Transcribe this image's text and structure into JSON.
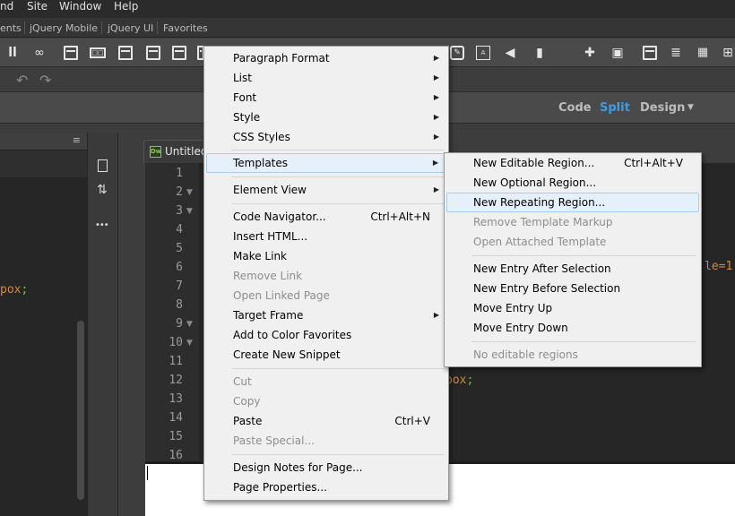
{
  "menubar": {
    "items": [
      "nd",
      "Site",
      "Window",
      "Help"
    ]
  },
  "insert_tabs": [
    "ents",
    "jQuery Mobile",
    "jQuery UI",
    "Favorites"
  ],
  "view_bar": {
    "code": "Code",
    "split": "Split",
    "design": "Design",
    "dropdown_arrow": "▼"
  },
  "document": {
    "tab_title": "Untitled",
    "dw_badge": "Dw"
  },
  "editor": {
    "line_numbers": [
      "1",
      "2",
      "3",
      "4",
      "5",
      "6",
      "7",
      "8",
      "9",
      "10",
      "11",
      "12",
      "13",
      "14",
      "15",
      "16"
    ],
    "left_fragment": "pox",
    "left_fragment_punct": ";",
    "right_fragment": "le=1",
    "box_fragment": "pox",
    "box_fragment_punct": ";"
  },
  "context_menu": {
    "items": [
      {
        "label": "Paragraph Format",
        "submenu": true
      },
      {
        "label": "List",
        "submenu": true
      },
      {
        "label": "Font",
        "submenu": true
      },
      {
        "label": "Style",
        "submenu": true
      },
      {
        "label": "CSS Styles",
        "submenu": true
      },
      {
        "label": "Templates",
        "submenu": true,
        "highlighted": true
      },
      {
        "label": "Element View",
        "submenu": true
      },
      {
        "label": "Code Navigator...",
        "shortcut": "Ctrl+Alt+N"
      },
      {
        "label": "Insert HTML..."
      },
      {
        "label": "Make Link"
      },
      {
        "label": "Remove Link",
        "disabled": true
      },
      {
        "label": "Open Linked Page",
        "disabled": true
      },
      {
        "label": "Target Frame",
        "submenu": true
      },
      {
        "label": "Add to Color Favorites"
      },
      {
        "label": "Create New Snippet"
      },
      {
        "label": "Cut",
        "disabled": true
      },
      {
        "label": "Copy",
        "disabled": true
      },
      {
        "label": "Paste",
        "shortcut": "Ctrl+V"
      },
      {
        "label": "Paste Special...",
        "disabled": true
      },
      {
        "label": "Design Notes for Page..."
      },
      {
        "label": "Page Properties..."
      }
    ]
  },
  "templates_submenu": {
    "items": [
      {
        "label": "New Editable Region...",
        "shortcut": "Ctrl+Alt+V"
      },
      {
        "label": "New Optional Region..."
      },
      {
        "label": "New Repeating Region...",
        "highlighted": true
      },
      {
        "label": "Remove Template Markup",
        "disabled": true
      },
      {
        "label": "Open Attached Template",
        "disabled": true
      },
      {
        "label": "New Entry After Selection"
      },
      {
        "label": "New Entry Before Selection"
      },
      {
        "label": "Move Entry Up"
      },
      {
        "label": "Move Entry Down"
      },
      {
        "label": "No editable regions",
        "disabled": true
      }
    ]
  },
  "colors": {
    "accent": "#3f9ae8",
    "code_green": "#77c043",
    "code_orange": "#d6873a",
    "menu_bg": "#f0f0f0",
    "menu_highlight": "#e5f0fb"
  },
  "icons": {
    "fold_marker": "▼",
    "submenu_arrow": "▶",
    "undo": "↶",
    "redo": "↷",
    "more": "•••",
    "sort": "⇅"
  }
}
